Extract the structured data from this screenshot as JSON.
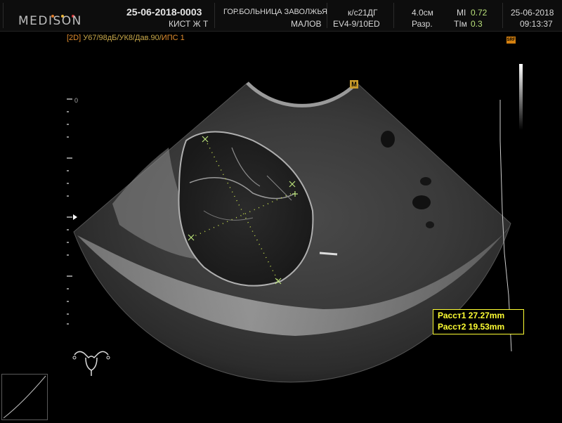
{
  "header": {
    "brand": "MEDISON",
    "logo_dot_colors": [
      "#e07b2a",
      "#e8b236",
      "#d83a3a"
    ],
    "study_id": "25-06-2018-0003",
    "diagnosis": "КИСТ Ж Т",
    "hospital": "ГОР.БОЛЬНИЦА ЗАВОЛЖЬЯ",
    "patient": "МАЛОВ",
    "exam": "к/с21ДГ",
    "probe": "EV4-9/10ED",
    "depth": "4.0см",
    "res_label": "Разр.",
    "mi_label": "MI",
    "mi_value": "0.72",
    "tim_label": "TIм",
    "tim_value": "0.3",
    "date": "25-06-2018",
    "time": "09:13:37"
  },
  "params": {
    "mode": "[2D]",
    "settings": "У67/98дБ/УК8/Дав.90/",
    "ips": "ИПС 1"
  },
  "icons": {
    "srf": "SRF",
    "m_marker": "M",
    "scale_zero": "0"
  },
  "measurements": [
    {
      "label": "Расст1",
      "value": "27.27mm"
    },
    {
      "label": "Расст2",
      "value": "19.53mm"
    }
  ],
  "colors": {
    "accent_yellow": "#ffff33",
    "measure_green": "#b9e07a",
    "param_orange": "#c8a84a"
  }
}
